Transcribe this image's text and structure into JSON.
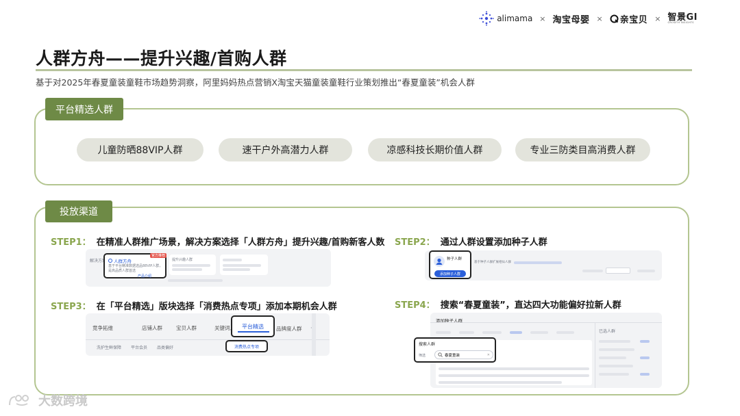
{
  "header": {
    "logos": {
      "alimama": "alimama",
      "taobao_muying": "淘宝母婴",
      "qinbaobei": "亲宝贝",
      "zhijing": "智景GI",
      "zhijing_sub": "GROWTH INSIGHTS",
      "sep": "×"
    }
  },
  "title": "人群方舟——提升兴趣/首购人群",
  "subtitle": "基于对2025年春夏童装童鞋市场趋势洞察，阿里妈妈热点营销X淘宝天猫童装童鞋行业策划推出“春夏童装”机会人群",
  "platform_section": {
    "tag": "平台精选人群",
    "pills": [
      "儿童防晒88VIP人群",
      "速干户外高潜力人群",
      "凉感科技长期价值人群",
      "专业三防类目高消费人群"
    ]
  },
  "channel_section": {
    "tag": "投放渠道",
    "steps": [
      {
        "no": "STEP1：",
        "text": "在精准人群推广场景，解决方案选择「人群方舟」提升兴趣/首购新客人数"
      },
      {
        "no": "STEP2：",
        "text": "通过人群设置添加种子人群"
      },
      {
        "no": "STEP3：",
        "text": "在「平台精选」版块选择「消费热点专项」添加本期机会人群"
      },
      {
        "no": "STEP4：",
        "text": "搜索“春夏童装”，直达四大功能偏好拉新人群"
      }
    ]
  },
  "screenshots": {
    "s1": {
      "left_label": "解决方案",
      "card_title": "人群方舟",
      "badge": "官方推荐",
      "card_desc": "基于平台精准数据选品88VIP人群，是高品质人群首选",
      "card_link": "产品介绍",
      "col2_title": "提升兴趣人群"
    },
    "s2": {
      "card_title": "种子人群",
      "card_sub": "基于种子人群扩展相似人群",
      "button": "添加种子人群"
    },
    "s3": {
      "tabs": [
        "竞争拓维",
        "店铺人群",
        "宝贝人群",
        "关键词人群",
        "平台精选",
        "品牌度人群"
      ],
      "subtabs": [
        "洗护生鲜保障",
        "平台会员",
        "品类偏好",
        "消费热点专项"
      ]
    },
    "s4": {
      "header": "添加种子人群",
      "search_label": "搜索人群",
      "search_prefix": "筛选",
      "search_value": "春夏童装",
      "right_head": "已选人群"
    }
  },
  "watermark": "大数跨境"
}
